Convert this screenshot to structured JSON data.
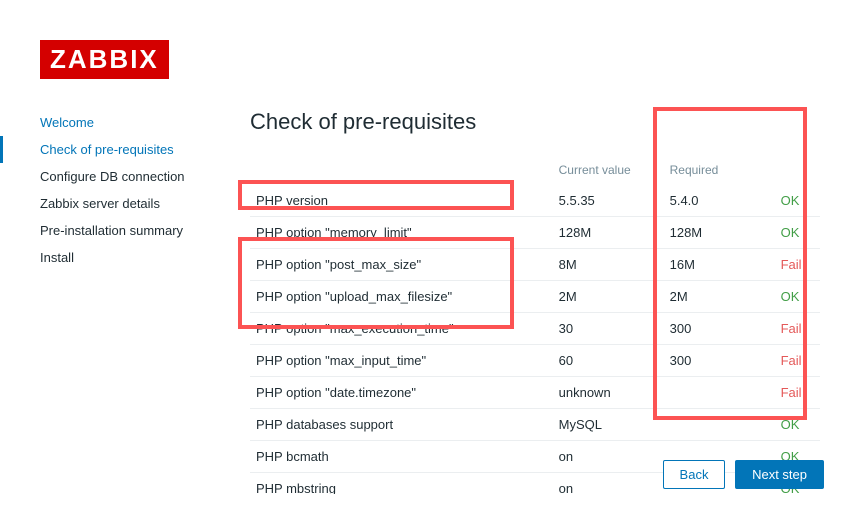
{
  "logo_text": "ZABBIX",
  "page_title": "Check of pre-requisites",
  "sidebar": {
    "items": [
      {
        "label": "Welcome",
        "state": "done"
      },
      {
        "label": "Check of pre-requisites",
        "state": "active"
      },
      {
        "label": "Configure DB connection",
        "state": ""
      },
      {
        "label": "Zabbix server details",
        "state": ""
      },
      {
        "label": "Pre-installation summary",
        "state": ""
      },
      {
        "label": "Install",
        "state": ""
      }
    ]
  },
  "table": {
    "headers": {
      "name": "",
      "current": "Current value",
      "required": "Required",
      "status": ""
    },
    "rows": [
      {
        "name": "PHP version",
        "current": "5.5.35",
        "required": "5.4.0",
        "status": "OK"
      },
      {
        "name": "PHP option \"memory_limit\"",
        "current": "128M",
        "required": "128M",
        "status": "OK"
      },
      {
        "name": "PHP option \"post_max_size\"",
        "current": "8M",
        "required": "16M",
        "status": "Fail"
      },
      {
        "name": "PHP option \"upload_max_filesize\"",
        "current": "2M",
        "required": "2M",
        "status": "OK"
      },
      {
        "name": "PHP option \"max_execution_time\"",
        "current": "30",
        "required": "300",
        "status": "Fail"
      },
      {
        "name": "PHP option \"max_input_time\"",
        "current": "60",
        "required": "300",
        "status": "Fail"
      },
      {
        "name": "PHP option \"date.timezone\"",
        "current": "unknown",
        "required": "",
        "status": "Fail"
      },
      {
        "name": "PHP databases support",
        "current": "MySQL",
        "required": "",
        "status": "OK"
      },
      {
        "name": "PHP bcmath",
        "current": "on",
        "required": "",
        "status": "OK"
      },
      {
        "name": "PHP mbstring",
        "current": "on",
        "required": "",
        "status": "OK"
      }
    ]
  },
  "buttons": {
    "back": "Back",
    "next": "Next step"
  },
  "status_labels": {
    "ok": "OK",
    "fail": "Fail"
  }
}
